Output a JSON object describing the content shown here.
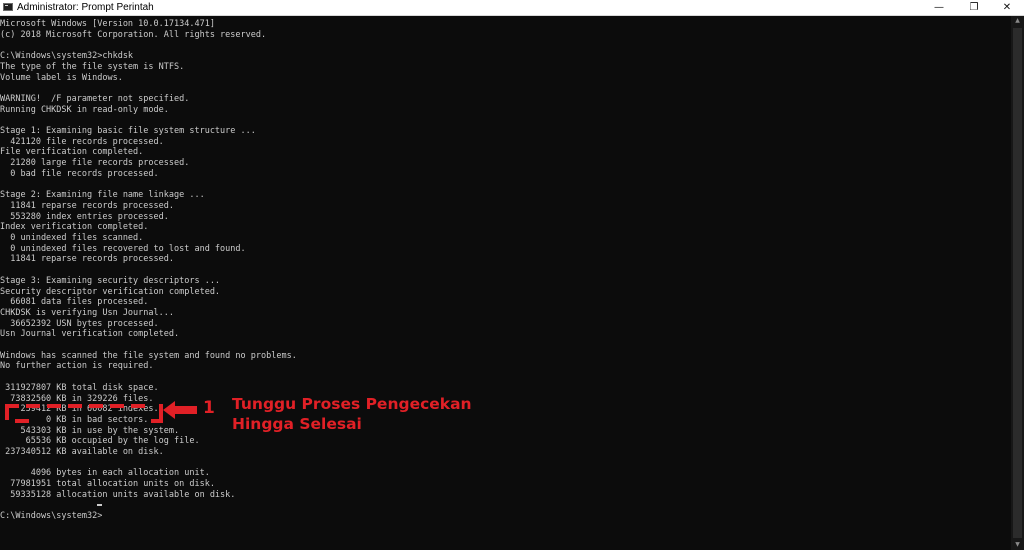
{
  "window": {
    "title": "Administrator: Prompt Perintah",
    "minimize_glyph": "—",
    "maximize_glyph": "❐",
    "close_glyph": "✕"
  },
  "console": {
    "lines": [
      "Microsoft Windows [Version 10.0.17134.471]",
      "(c) 2018 Microsoft Corporation. All rights reserved.",
      "",
      "C:\\Windows\\system32>chkdsk",
      "The type of the file system is NTFS.",
      "Volume label is Windows.",
      "",
      "WARNING!  /F parameter not specified.",
      "Running CHKDSK in read-only mode.",
      "",
      "Stage 1: Examining basic file system structure ...",
      "  421120 file records processed.",
      "File verification completed.",
      "  21280 large file records processed.",
      "  0 bad file records processed.",
      "",
      "Stage 2: Examining file name linkage ...",
      "  11841 reparse records processed.",
      "  553280 index entries processed.",
      "Index verification completed.",
      "  0 unindexed files scanned.",
      "  0 unindexed files recovered to lost and found.",
      "  11841 reparse records processed.",
      "",
      "Stage 3: Examining security descriptors ...",
      "Security descriptor verification completed.",
      "  66081 data files processed.",
      "CHKDSK is verifying Usn Journal...",
      "  36652392 USN bytes processed.",
      "Usn Journal verification completed.",
      "",
      "Windows has scanned the file system and found no problems.",
      "No further action is required.",
      "",
      " 311927807 KB total disk space.",
      "  73832560 KB in 329226 files.",
      "    239412 KB in 66082 indexes.",
      "         0 KB in bad sectors.",
      "    543303 KB in use by the system.",
      "     65536 KB occupied by the log file.",
      " 237340512 KB available on disk.",
      "",
      "      4096 bytes in each allocation unit.",
      "  77981951 total allocation units on disk.",
      "  59335128 allocation units available on disk.",
      "",
      "C:\\Windows\\system32>"
    ]
  },
  "scrollbar": {
    "up_glyph": "▲",
    "down_glyph": "▼"
  },
  "annotation": {
    "number": "1",
    "text_line1": "Tunggu Proses Pengecekan",
    "text_line2": "Hingga Selesai",
    "color": "#e12026"
  }
}
